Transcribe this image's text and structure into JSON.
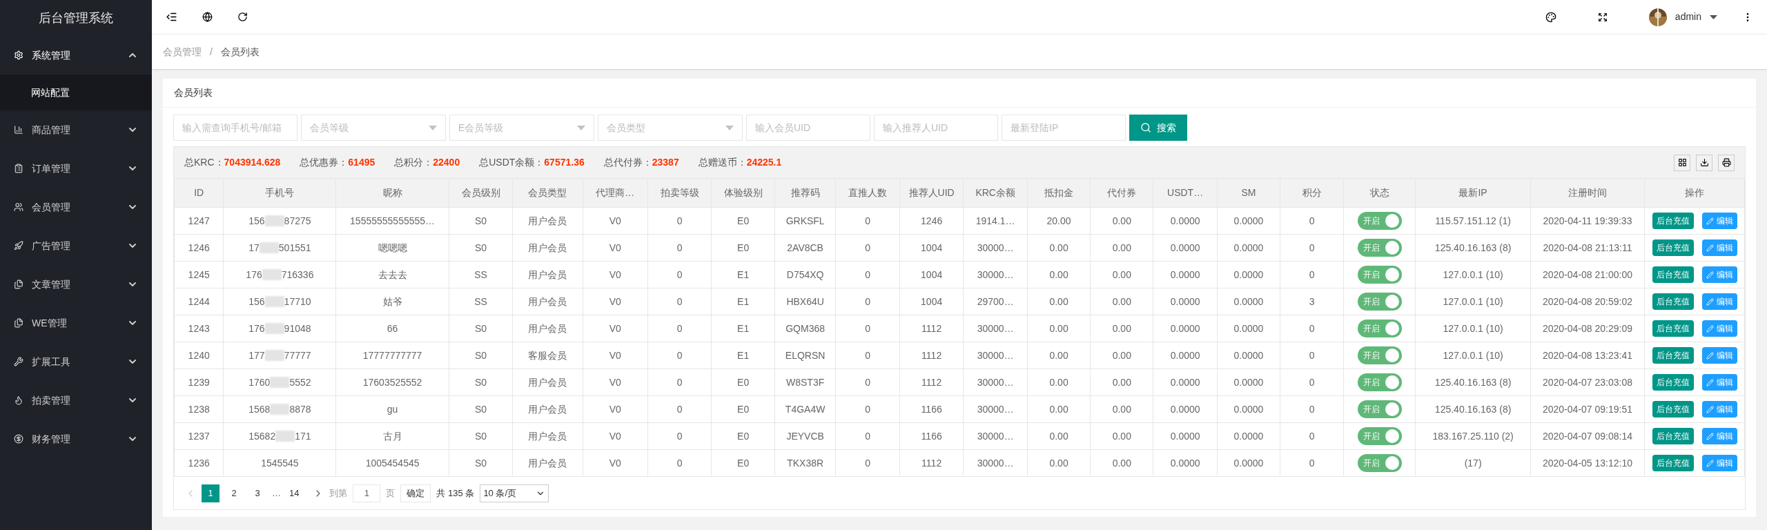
{
  "sidebar": {
    "title": "后台管理系统",
    "items": [
      {
        "label": "系统管理",
        "expanded": true,
        "children": [
          {
            "label": "网站配置",
            "selected": true
          }
        ]
      },
      {
        "label": "商品管理",
        "expanded": false
      },
      {
        "label": "订单管理",
        "expanded": false
      },
      {
        "label": "会员管理",
        "expanded": false
      },
      {
        "label": "广告管理",
        "expanded": false
      },
      {
        "label": "文章管理",
        "expanded": false
      },
      {
        "label": "WE管理",
        "expanded": false
      },
      {
        "label": "扩展工具",
        "expanded": false
      },
      {
        "label": "拍卖管理",
        "expanded": false
      },
      {
        "label": "财务管理",
        "expanded": false
      }
    ]
  },
  "topbar": {
    "user": "admin"
  },
  "breadcrumb": {
    "items": [
      "会员管理",
      "会员列表"
    ],
    "separator": "/"
  },
  "card": {
    "title": "会员列表"
  },
  "filters": [
    {
      "kind": "input",
      "placeholder": "输入需查询手机号/邮箱"
    },
    {
      "kind": "select",
      "placeholder": "会员等级"
    },
    {
      "kind": "select",
      "placeholder": "E会员等级"
    },
    {
      "kind": "select",
      "placeholder": "会员类型"
    },
    {
      "kind": "input",
      "placeholder": "输入会员UID"
    },
    {
      "kind": "input",
      "placeholder": "输入推荐人UID"
    },
    {
      "kind": "input",
      "placeholder": "最新登陆IP"
    }
  ],
  "search_button": "搜索",
  "summary": [
    {
      "label": "总KRC：",
      "value": "7043914.628"
    },
    {
      "label": "总优惠券：",
      "value": "61495"
    },
    {
      "label": "总积分：",
      "value": "22400"
    },
    {
      "label": "总USDT余额：",
      "value": "67571.36"
    },
    {
      "label": "总代付券：",
      "value": "23387"
    },
    {
      "label": "总赠送币：",
      "value": "24225.1"
    }
  ],
  "table": {
    "columns": [
      "ID",
      "手机号",
      "昵称",
      "会员级别",
      "会员类型",
      "代理商…",
      "拍卖等级",
      "体验级别",
      "推荐码",
      "直推人数",
      "推荐人UID",
      "KRC余额",
      "抵扣金",
      "代付券",
      "USDT…",
      "SM",
      "积分",
      "状态",
      "最新IP",
      "注册时间",
      "操作"
    ],
    "rows": [
      {
        "cells": [
          "1247",
          {
            "head": "156",
            "tail": "87275"
          },
          "15555555555555…",
          "S0",
          "用户会员",
          "V0",
          "0",
          "E0",
          "GRKSFL",
          "0",
          "1246",
          "1914.1…",
          "20.00",
          "0.00",
          "0.0000",
          "0.0000",
          "0",
          {
            "label": "开启",
            "on": true
          },
          "115.57.151.12 (1)",
          "2020-04-11 19:39:33",
          [
            "后台充值",
            "编辑"
          ]
        ]
      },
      {
        "cells": [
          "1246",
          {
            "head": "17",
            "tail": "501551"
          },
          "嗯嗯嗯",
          "S0",
          "用户会员",
          "V0",
          "0",
          "E0",
          "2AV8CB",
          "0",
          "1004",
          "30000…",
          "0.00",
          "0.00",
          "0.0000",
          "0.0000",
          "0",
          {
            "label": "开启",
            "on": true
          },
          "125.40.16.163 (8)",
          "2020-04-08 21:13:11",
          [
            "后台充值",
            "编辑"
          ]
        ]
      },
      {
        "cells": [
          "1245",
          {
            "head": "176",
            "tail": "716336"
          },
          "去去去",
          "SS",
          "用户会员",
          "V0",
          "0",
          "E1",
          "D754XQ",
          "0",
          "1004",
          "30000…",
          "0.00",
          "0.00",
          "0.0000",
          "0.0000",
          "0",
          {
            "label": "开启",
            "on": true
          },
          "127.0.0.1 (10)",
          "2020-04-08 21:00:00",
          [
            "后台充值",
            "编辑"
          ]
        ]
      },
      {
        "cells": [
          "1244",
          {
            "head": "156",
            "tail": "17710"
          },
          "姑爷",
          "SS",
          "用户会员",
          "V0",
          "0",
          "E1",
          "HBX64U",
          "0",
          "1004",
          "29700…",
          "0.00",
          "0.00",
          "0.0000",
          "0.0000",
          "3",
          {
            "label": "开启",
            "on": true
          },
          "127.0.0.1 (10)",
          "2020-04-08 20:59:02",
          [
            "后台充值",
            "编辑"
          ]
        ]
      },
      {
        "cells": [
          "1243",
          {
            "head": "176",
            "tail": "91048"
          },
          "66",
          "S0",
          "用户会员",
          "V0",
          "0",
          "E1",
          "GQM368",
          "0",
          "1112",
          "30000…",
          "0.00",
          "0.00",
          "0.0000",
          "0.0000",
          "0",
          {
            "label": "开启",
            "on": true
          },
          "127.0.0.1 (10)",
          "2020-04-08 20:29:09",
          [
            "后台充值",
            "编辑"
          ]
        ]
      },
      {
        "cells": [
          "1240",
          {
            "head": "177",
            "tail": "77777"
          },
          "17777777777",
          "S0",
          "客服会员",
          "V0",
          "0",
          "E1",
          "ELQRSN",
          "0",
          "1112",
          "30000…",
          "0.00",
          "0.00",
          "0.0000",
          "0.0000",
          "0",
          {
            "label": "开启",
            "on": true
          },
          "127.0.0.1 (10)",
          "2020-04-08 13:23:41",
          [
            "后台充值",
            "编辑"
          ]
        ]
      },
      {
        "cells": [
          "1239",
          {
            "head": "1760",
            "tail": "5552"
          },
          "17603525552",
          "S0",
          "用户会员",
          "V0",
          "0",
          "E0",
          "W8ST3F",
          "0",
          "1112",
          "30000…",
          "0.00",
          "0.00",
          "0.0000",
          "0.0000",
          "0",
          {
            "label": "开启",
            "on": true
          },
          "125.40.16.163 (8)",
          "2020-04-07 23:03:08",
          [
            "后台充值",
            "编辑"
          ]
        ]
      },
      {
        "cells": [
          "1238",
          {
            "head": "1568",
            "tail": "8878"
          },
          "gu",
          "S0",
          "用户会员",
          "V0",
          "0",
          "E0",
          "T4GA4W",
          "0",
          "1166",
          "30000…",
          "0.00",
          "0.00",
          "0.0000",
          "0.0000",
          "0",
          {
            "label": "开启",
            "on": true
          },
          "125.40.16.163 (8)",
          "2020-04-07 09:19:51",
          [
            "后台充值",
            "编辑"
          ]
        ]
      },
      {
        "cells": [
          "1237",
          {
            "head": "15682",
            "tail": "171"
          },
          "古月",
          "S0",
          "用户会员",
          "V0",
          "0",
          "E0",
          "JEYVCB",
          "0",
          "1166",
          "30000…",
          "0.00",
          "0.00",
          "0.0000",
          "0.0000",
          "0",
          {
            "label": "开启",
            "on": true
          },
          "183.167.25.110 (2)",
          "2020-04-07 09:08:14",
          [
            "后台充值",
            "编辑"
          ]
        ]
      },
      {
        "cells": [
          "1236",
          {
            "head": "1545545"
          },
          "1005454545",
          "S0",
          "用户会员",
          "V0",
          "0",
          "E0",
          "TKX38R",
          "0",
          "1112",
          "30000…",
          "0.00",
          "0.00",
          "0.0000",
          "0.0000",
          "0",
          {
            "label": "开启",
            "on": true
          },
          "(17)",
          "2020-04-05 13:12:10",
          [
            "后台充值",
            "编辑"
          ]
        ]
      }
    ]
  },
  "pagination": {
    "pages": [
      {
        "label": "1",
        "selected": true
      },
      {
        "label": "2",
        "selected": false
      },
      {
        "label": "3",
        "selected": false
      }
    ],
    "ellipsis": "…",
    "last": "14",
    "goto_label": "到第",
    "goto_value": "1",
    "page_unit": "页",
    "confirm": "确定",
    "total": "共 135 条",
    "page_size": "10 条/页"
  }
}
